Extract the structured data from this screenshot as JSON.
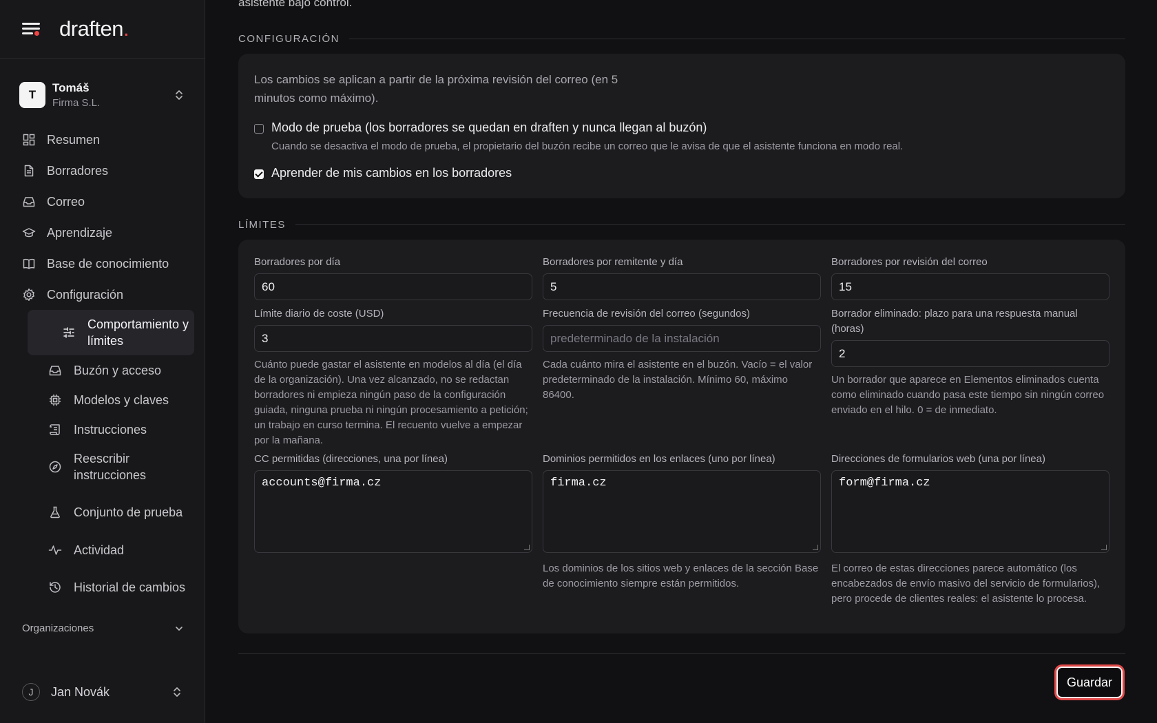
{
  "brand": {
    "name": "draften",
    "dot": "."
  },
  "account": {
    "initial": "T",
    "name": "Tomáš",
    "org": "Firma S.L."
  },
  "nav": {
    "items": [
      {
        "label": "Resumen",
        "icon": "grid-icon"
      },
      {
        "label": "Borradores",
        "icon": "document-icon"
      },
      {
        "label": "Correo",
        "icon": "inbox-icon"
      },
      {
        "label": "Aprendizaje",
        "icon": "graduation-cap-icon"
      },
      {
        "label": "Base de conocimiento",
        "icon": "book-icon"
      },
      {
        "label": "Configuración",
        "icon": "gear-icon"
      }
    ],
    "sub_items": [
      {
        "label": "Comportamiento y límites",
        "icon": "sliders-icon",
        "active": true
      },
      {
        "label": "Buzón y acceso",
        "icon": "inbox-icon"
      },
      {
        "label": "Modelos y claves",
        "icon": "chip-icon"
      },
      {
        "label": "Instrucciones",
        "icon": "scroll-icon"
      },
      {
        "label": "Reescribir instrucciones",
        "icon": "compass-icon"
      },
      {
        "label": "Conjunto de prueba",
        "icon": "flask-icon"
      },
      {
        "label": "Actividad",
        "icon": "activity-icon"
      },
      {
        "label": "Historial de cambios",
        "icon": "history-icon"
      }
    ]
  },
  "organizations": {
    "label": "Organizaciones"
  },
  "user": {
    "initial": "J",
    "name": "Jan Novák"
  },
  "main": {
    "intro_tail": "asistente bajo control.",
    "config": {
      "heading": "CONFIGURACIÓN",
      "description": "Los cambios se aplican a partir de la próxima revisión del correo (en 5 minutos como máximo).",
      "test_mode": {
        "label": "Modo de prueba (los borradores se quedan en draften y nunca llegan al buzón)",
        "help": "Cuando se desactiva el modo de prueba, el propietario del buzón recibe un correo que le avisa de que el asistente funciona en modo real.",
        "checked": false
      },
      "learn": {
        "label": "Aprender de mis cambios en los borradores",
        "checked": true
      }
    },
    "limits": {
      "heading": "LÍMITES",
      "drafts_per_day": {
        "label": "Borradores por día",
        "value": "60"
      },
      "drafts_per_sender": {
        "label": "Borradores por remitente y día",
        "value": "5"
      },
      "drafts_per_check": {
        "label": "Borradores por revisión del correo",
        "value": "15"
      },
      "daily_cost": {
        "label": "Límite diario de coste (USD)",
        "value": "3",
        "help": "Cuánto puede gastar el asistente en modelos al día (el día de la organización). Una vez alcanzado, no se redactan borradores ni empieza ningún paso de la configuración guiada, ninguna prueba ni ningún procesamiento a petición; un trabajo en curso termina. El recuento vuelve a empezar por la mañana."
      },
      "check_frequency": {
        "label": "Frecuencia de revisión del correo (segundos)",
        "placeholder": "predeterminado de la instalación",
        "help": "Cada cuánto mira el asistente en el buzón. Vacío = el valor predeterminado de la instalación. Mínimo 60, máximo 86400."
      },
      "deleted_draft": {
        "label": "Borrador eliminado: plazo para una respuesta manual (horas)",
        "value": "2",
        "help": "Un borrador que aparece en Elementos eliminados cuenta como eliminado cuando pasa este tiempo sin ningún correo enviado en el hilo. 0 = de inmediato."
      },
      "allowed_cc": {
        "label": "CC permitidas (direcciones, una por línea)",
        "value": "accounts@firma.cz"
      },
      "allowed_domains": {
        "label": "Dominios permitidos en los enlaces (uno por línea)",
        "value": "firma.cz",
        "help": "Los dominios de los sitios web y enlaces de la sección Base de conocimiento siempre están permitidos."
      },
      "web_forms": {
        "label": "Direcciones de formularios web (una por línea)",
        "value": "form@firma.cz",
        "help": "El correo de estas direcciones parece automático (los encabezados de envío masivo del servicio de formularios), pero procede de clientes reales: el asistente lo procesa."
      }
    },
    "save_label": "Guardar"
  },
  "colors": {
    "accent": "#ef4444",
    "background": "#111113",
    "sidebar": "#18181b",
    "card": "#1c1c1f"
  }
}
